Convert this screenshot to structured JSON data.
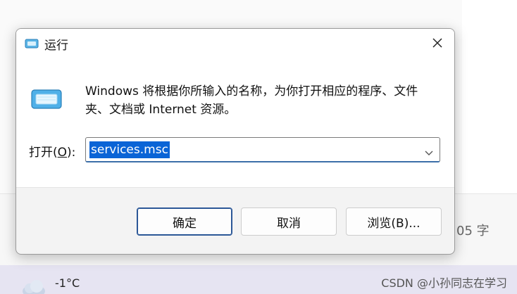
{
  "background": {
    "word_count": "05 字",
    "weather_temp": "-1°C",
    "watermark": "CSDN @小孙同志在学习"
  },
  "dialog": {
    "title": "运行",
    "description": "Windows 将根据你所输入的名称，为你打开相应的程序、文件夹、文档或 Internet 资源。",
    "open_label_prefix": "打开(",
    "open_label_key": "O",
    "open_label_suffix": "):",
    "input_value": "services.msc",
    "buttons": {
      "ok": "确定",
      "cancel": "取消",
      "browse": "浏览(B)..."
    }
  },
  "colors": {
    "accent": "#0a64d6",
    "default_button_border": "#2b5797"
  },
  "icons": [
    "run-app-icon",
    "close-icon",
    "chevron-down-icon",
    "cloud-icon"
  ]
}
